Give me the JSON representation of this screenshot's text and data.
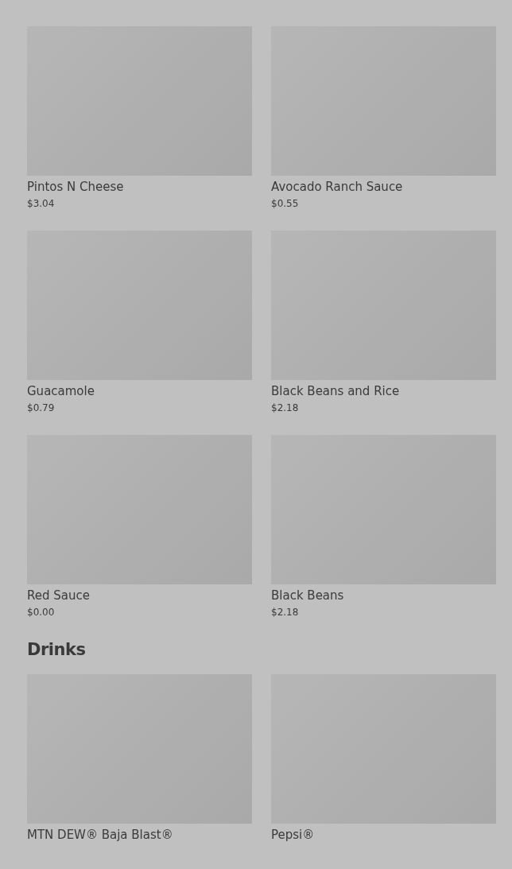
{
  "sections": [
    {
      "items": [
        {
          "name": "Pintos N Cheese",
          "price": "$3.04"
        },
        {
          "name": "Avocado Ranch Sauce",
          "price": "$0.55"
        },
        {
          "name": "Guacamole",
          "price": "$0.79"
        },
        {
          "name": "Black Beans and Rice",
          "price": "$2.18"
        },
        {
          "name": "Red Sauce",
          "price": "$0.00"
        },
        {
          "name": "Black Beans",
          "price": "$2.18"
        }
      ]
    },
    {
      "title": "Drinks",
      "items": [
        {
          "name": "MTN DEW® Baja Blast®"
        },
        {
          "name": "Pepsi®"
        }
      ]
    }
  ]
}
